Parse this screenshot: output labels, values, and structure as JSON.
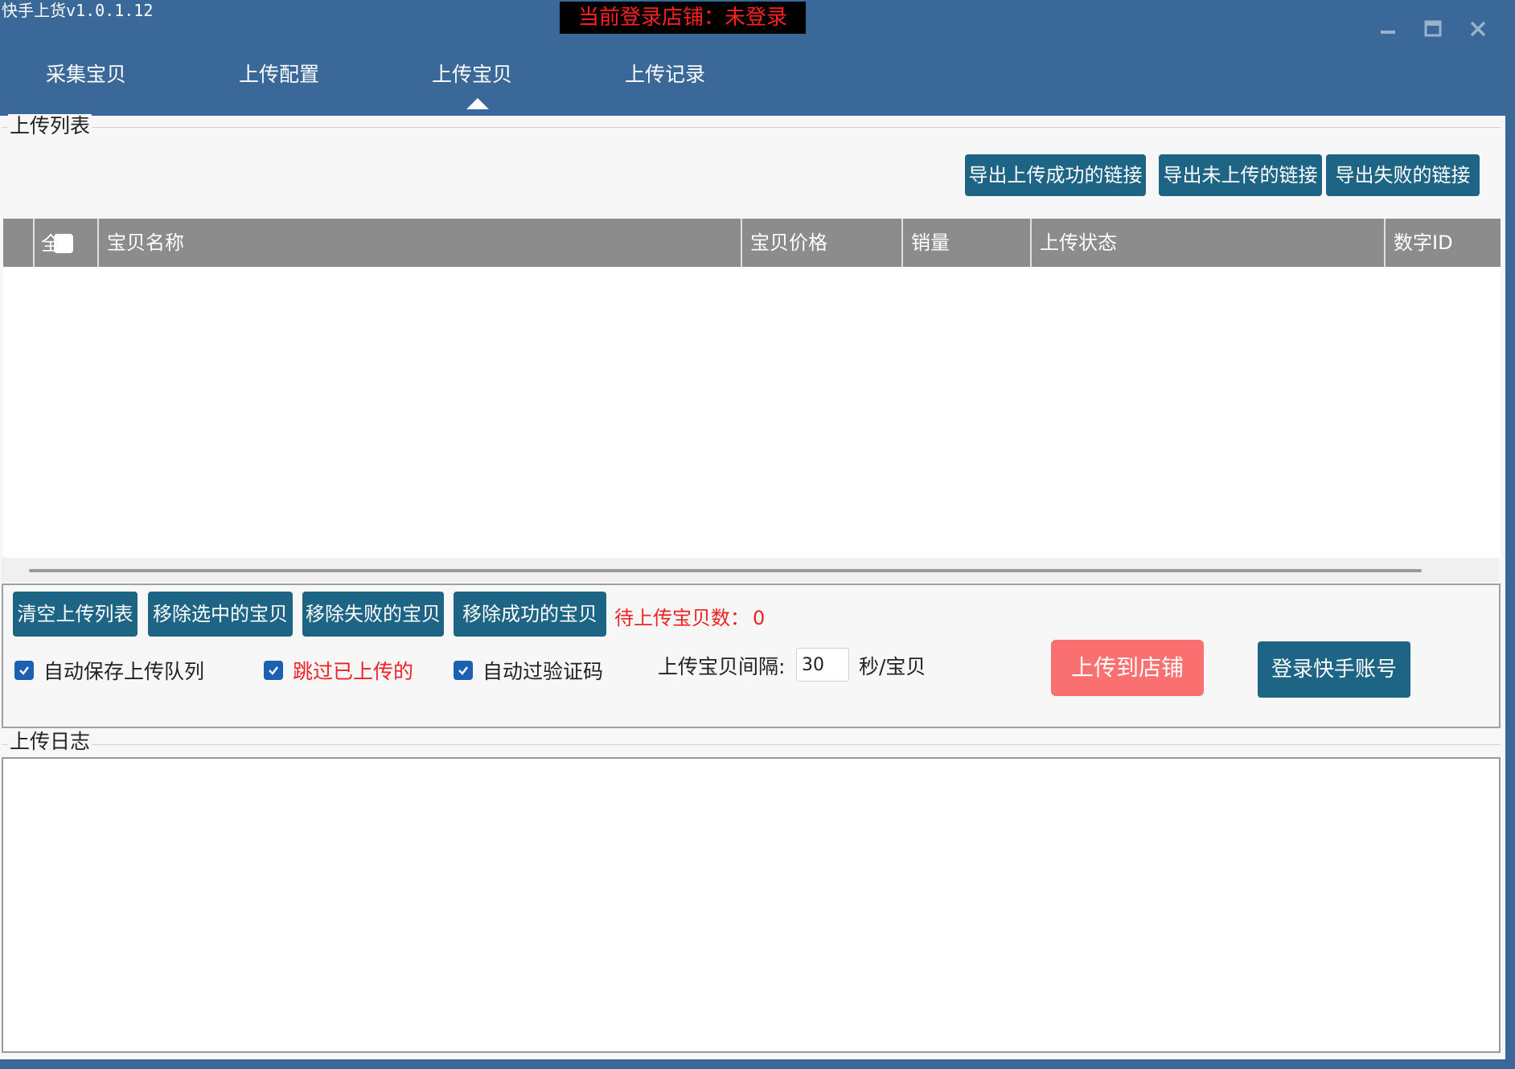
{
  "window": {
    "title": "快手上货v1.0.1.12",
    "login_status": "当前登录店铺：未登录"
  },
  "nav": {
    "tabs": [
      {
        "label": "采集宝贝"
      },
      {
        "label": "上传配置"
      },
      {
        "label": "上传宝贝",
        "active": true
      },
      {
        "label": "上传记录"
      }
    ]
  },
  "upload_list": {
    "group_title": "上传列表",
    "export_buttons": [
      "导出上传成功的链接",
      "导出未上传的链接",
      "导出失败的链接"
    ],
    "columns": {
      "select_all": "全选",
      "name": "宝贝名称",
      "price": "宝贝价格",
      "sales": "销量",
      "status": "上传状态",
      "id": "数字ID"
    },
    "rows": []
  },
  "controls": {
    "buttons": [
      "清空上传列表",
      "移除选中的宝贝",
      "移除失败的宝贝",
      "移除成功的宝贝"
    ],
    "pending_label": "待上传宝贝数：",
    "pending_count": "0",
    "checkboxes": [
      {
        "label": "自动保存上传队列",
        "checked": true
      },
      {
        "label": "跳过已上传的",
        "checked": true
      },
      {
        "label": "自动过验证码",
        "checked": true
      }
    ],
    "interval_label": "上传宝贝间隔:",
    "interval_value": "30",
    "interval_unit": "秒/宝贝",
    "upload_button": "上传到店铺",
    "login_button": "登录快手账号"
  },
  "log": {
    "group_title": "上传日志"
  },
  "colors": {
    "header_bg": "#3a6898",
    "button_dark": "#1e6485",
    "upload_button": "#fa7070",
    "checkbox": "#1c5fb3",
    "warning_text": "#ee2222"
  },
  "icons": {
    "minimize": "minimize-icon",
    "maximize": "maximize-icon",
    "close": "close-icon",
    "check": "check-icon"
  }
}
